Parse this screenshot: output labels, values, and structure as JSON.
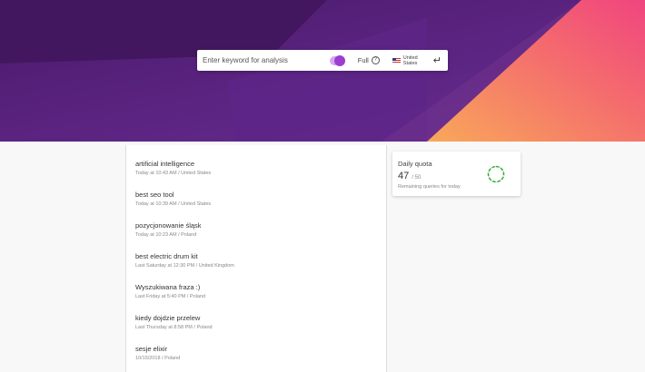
{
  "search": {
    "placeholder": "Enter keyword for analysis",
    "mode_label": "Full",
    "help_icon": "?",
    "country_label": "United States",
    "enter_icon": "↵"
  },
  "history": [
    {
      "keyword": "artificial intelligence",
      "meta": "Today at 10:43 AM / United States"
    },
    {
      "keyword": "best seo tool",
      "meta": "Today at 10:39 AM / United States"
    },
    {
      "keyword": "pozycjonowanie śląsk",
      "meta": "Today at 10:23 AM / Poland"
    },
    {
      "keyword": "best electric drum kit",
      "meta": "Last Saturday at 12:30 PM / United Kingdom"
    },
    {
      "keyword": "Wyszukiwana fraza :)",
      "meta": "Last Friday at 5:40 PM / Poland"
    },
    {
      "keyword": "kiedy dojdzie przelew",
      "meta": "Last Thursday at 8:58 PM / Poland"
    },
    {
      "keyword": "sesje elixir",
      "meta": "10/15/2018 / Poland"
    }
  ],
  "quota": {
    "title": "Daily quota",
    "used": "47",
    "total": "/ 50",
    "caption": "Remaining queries for today",
    "remaining_fraction": 0.94,
    "ring_color": "#2db52d"
  },
  "colors": {
    "hero_purple": "#4c1d6e",
    "hero_pink": "#f0557a",
    "hero_orange": "#f9a85a",
    "toggle_accent": "#9b3fd3"
  }
}
